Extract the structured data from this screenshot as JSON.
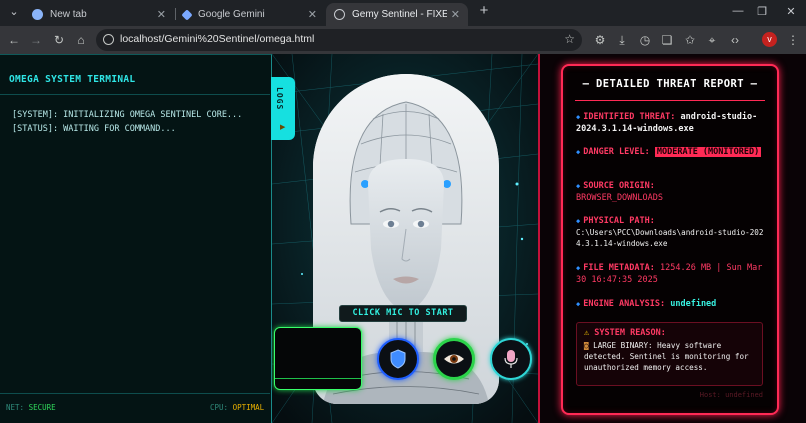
{
  "browser": {
    "tabs": [
      {
        "title": "New tab"
      },
      {
        "title": "Google Gemini"
      },
      {
        "title": "Gemy Sentinel - FIXED VERSION"
      }
    ],
    "url": "localhost/Gemini%20Sentinel/omega.html",
    "profile_initial": "v"
  },
  "terminal": {
    "title": "OMEGA SYSTEM TERMINAL",
    "lines": [
      "[SYSTEM]: INITIALIZING OMEGA SENTINEL CORE...",
      "[STATUS]: WAITING FOR COMMAND..."
    ],
    "net_label": "NET:",
    "net_value": "SECURE",
    "cpu_label": "CPU:",
    "cpu_value": "OPTIMAL",
    "logs_tab": "LOGS"
  },
  "center": {
    "mic_hint": "CLICK MIC TO START",
    "buttons": [
      "shield-icon",
      "eye-icon",
      "microphone-icon"
    ]
  },
  "report": {
    "title": "— DETAILED THREAT REPORT —",
    "threat_label": "IDENTIFIED THREAT:",
    "threat_value": "android-studio-2024.3.1.14-windows.exe",
    "danger_label": "DANGER LEVEL:",
    "danger_value": "MODERATE (MONITORED)",
    "source_label": "SOURCE ORIGIN:",
    "source_value": "BROWSER_DOWNLOADS",
    "path_label": "PHYSICAL PATH:",
    "path_value": "C:\\Users\\PCC\\Downloads\\android-studio-2024.3.1.14-windows.exe",
    "meta_label": "FILE METADATA:",
    "meta_value": "1254.26 MB | Sun Mar 30 16:47:35 2025",
    "engine_label": "ENGINE ANALYSIS:",
    "engine_value": "undefined",
    "reason_label": "SYSTEM REASON:",
    "reason_text": "LARGE BINARY: Heavy software detected. Sentinel is monitoring for unauthorized memory access.",
    "host": "Host: undefined"
  },
  "colors": {
    "terminal_accent": "#2fe6e6",
    "report_accent": "#ff2a55",
    "engine_value": "#38f0e0"
  }
}
